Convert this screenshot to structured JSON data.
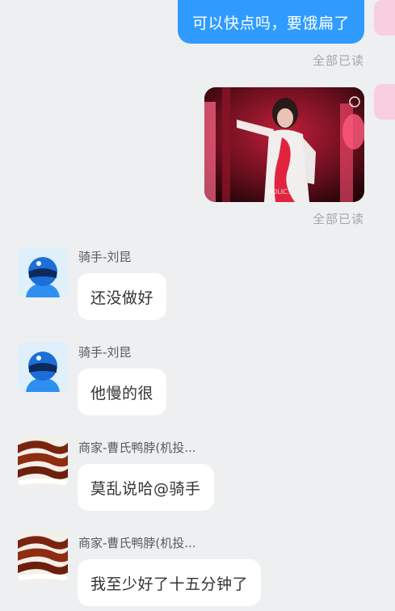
{
  "outgoing": [
    {
      "text": "可以快点吗，要饿扁了",
      "status": "全部已读"
    },
    {
      "image_watermark": "HOLIC...",
      "status": "全部已读"
    }
  ],
  "incoming": [
    {
      "sender": "骑手-刘昆",
      "text": "还没做好",
      "avatar": "rider-avatar"
    },
    {
      "sender": "骑手-刘昆",
      "text": "他慢的很",
      "avatar": "rider-avatar"
    },
    {
      "sender": "商家-曹氏鸭脖(机投...",
      "text": "莫乱说哈@骑手",
      "avatar": "merchant-avatar"
    },
    {
      "sender": "商家-曹氏鸭脖(机投...",
      "text": "我至少好了十五分钟了",
      "avatar": "merchant-avatar"
    }
  ],
  "colors": {
    "background": "#eeeff1",
    "outgoing_bubble": "#2f9bff",
    "incoming_bubble": "#ffffff",
    "read_status": "#a3a7ac"
  }
}
